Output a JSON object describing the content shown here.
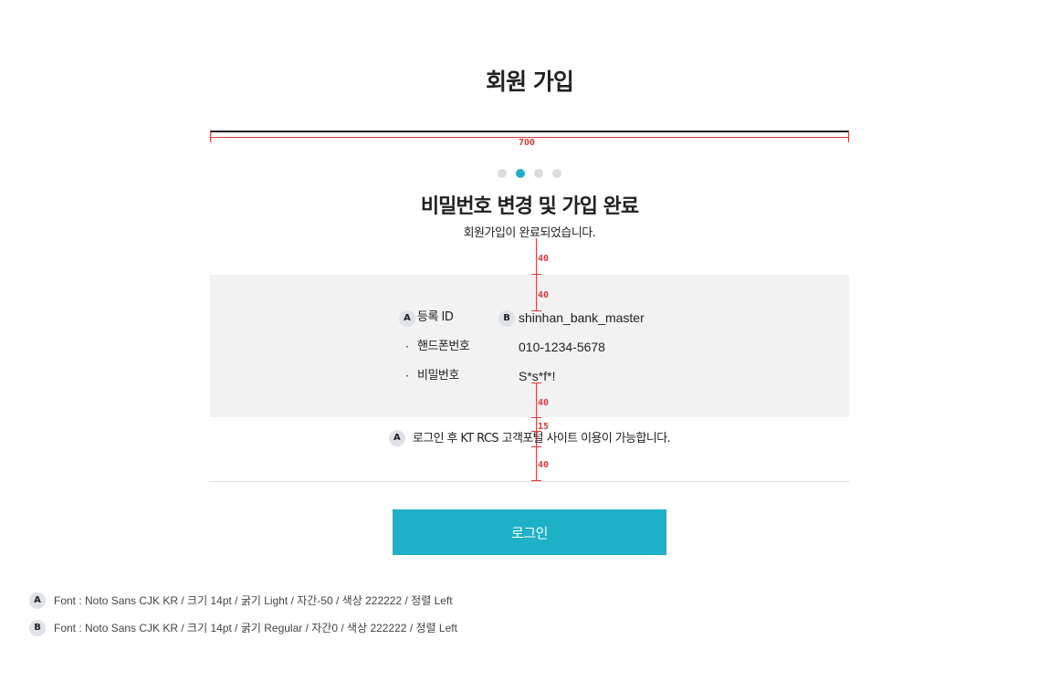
{
  "page_title": "회원 가입",
  "spec": {
    "width_label": "700",
    "gap_a": "40",
    "gap_b": "40",
    "gap_c": "40",
    "gap_d": "15",
    "gap_e": "40",
    "color": "#e03a3a"
  },
  "steps": {
    "count": 4,
    "active_index": 1,
    "active_color": "#1eb0c6",
    "inactive_color": "#dcdcdc"
  },
  "step_title": "비밀번호 변경 및 가입 완료",
  "step_desc": "회원가입이 완료되었습니다.",
  "info": {
    "rows": [
      {
        "key": "등록 ID",
        "value": "shinhan_bank_master"
      },
      {
        "key": "핸드폰번호",
        "value": "010-1234-5678"
      },
      {
        "key": "비밀번호",
        "value": "S*s*f*!"
      }
    ],
    "bullet": "·"
  },
  "badges": {
    "a": "A",
    "b": "B"
  },
  "notice": "로그인 후 KT RCS 고객포털 사이트 이용이 가능합니다.",
  "login_button": "로그인",
  "legend": [
    {
      "badge": "A",
      "text": "Font : Noto Sans CJK KR / 크기 14pt / 굵기 Light / 자간-50 / 색상 222222 / 정렬 Left"
    },
    {
      "badge": "B",
      "text": "Font : Noto Sans CJK KR / 크기 14pt / 굵기 Regular / 자간0 / 색상 222222 / 정렬 Left"
    }
  ],
  "colors": {
    "accent": "#1eb0c6",
    "text": "#222222",
    "box_bg": "#f2f2f2"
  }
}
